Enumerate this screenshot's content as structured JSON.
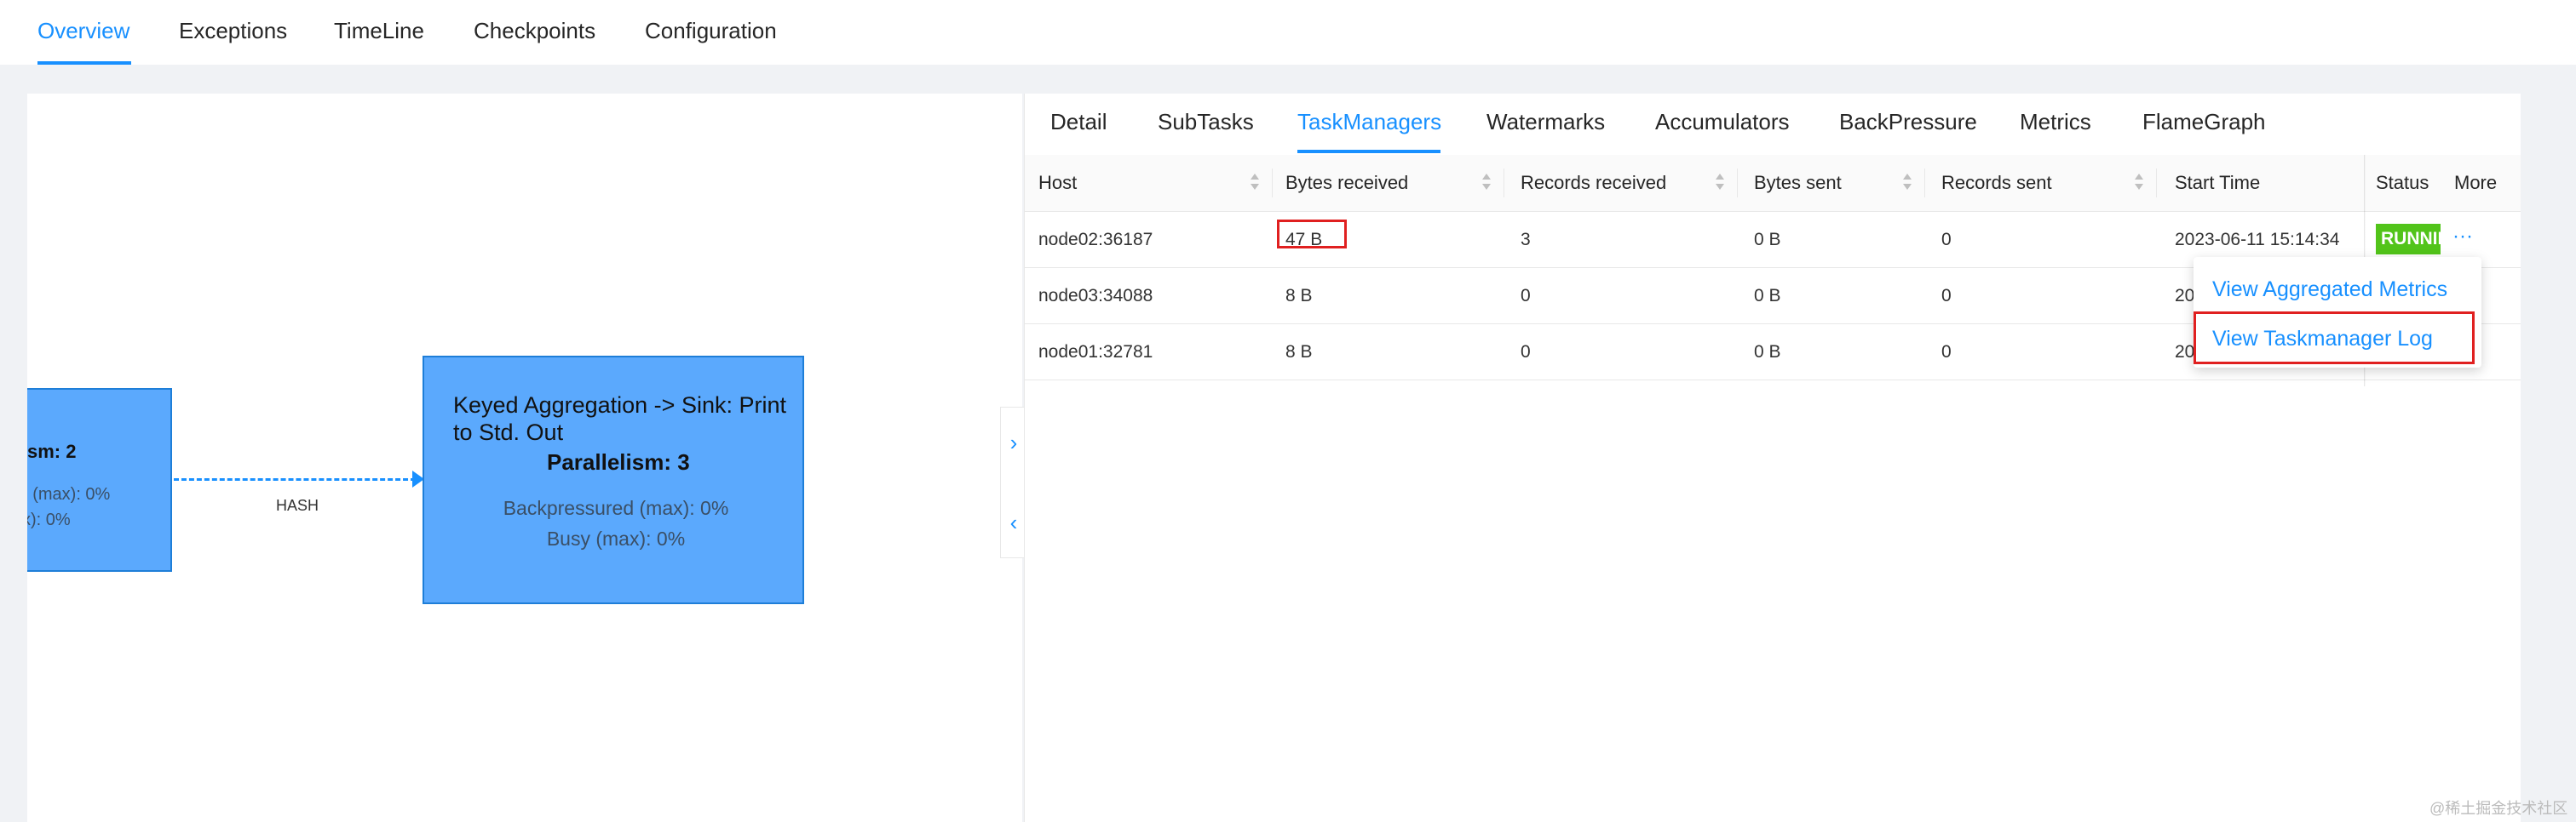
{
  "top_tabs": [
    "Overview",
    "Exceptions",
    "TimeLine",
    "Checkpoints",
    "Configuration"
  ],
  "graph": {
    "node1": {
      "parallelism": "sm: 2",
      "backpressured": ") (max): 0%",
      "busy": "x): 0%"
    },
    "node2": {
      "title": "Keyed Aggregation -> Sink: Print to Std. Out",
      "parallelism": "Parallelism: 3",
      "backpressured": "Backpressured (max): 0%",
      "busy": "Busy (max): 0%"
    },
    "edge_label": "HASH",
    "colors": {
      "node_fill": "#5ba9fd",
      "node_border": "#1e7ed8",
      "edge": "#1890ff"
    }
  },
  "collapse_icons": {
    "right": "›",
    "left": "‹"
  },
  "sub_tabs": [
    "Detail",
    "SubTasks",
    "TaskManagers",
    "Watermarks",
    "Accumulators",
    "BackPressure",
    "Metrics",
    "FlameGraph"
  ],
  "active_sub_tab": "TaskManagers",
  "table": {
    "headers": [
      "Host",
      "Bytes received",
      "Records received",
      "Bytes sent",
      "Records sent",
      "Start Time",
      "Status",
      "More"
    ],
    "rows": [
      {
        "host": "node02:36187",
        "bytes_received": "47 B",
        "records_received": "3",
        "bytes_sent": "0 B",
        "records_sent": "0",
        "start_time": "2023-06-11 15:14:34",
        "status": "RUNNING",
        "more": "···"
      },
      {
        "host": "node03:34088",
        "bytes_received": "8 B",
        "records_received": "0",
        "bytes_sent": "0 B",
        "records_sent": "0",
        "start_time": "20"
      },
      {
        "host": "node01:32781",
        "bytes_received": "8 B",
        "records_received": "0",
        "bytes_sent": "0 B",
        "records_sent": "0",
        "start_time": "20"
      }
    ]
  },
  "more_menu": {
    "items": [
      "View Aggregated Metrics",
      "View Taskmanager Log"
    ]
  },
  "accent_color": "#1890ff",
  "status_color": "#52c41a",
  "highlight_color": "#e02020",
  "watermark": "@稀土掘金技术社区"
}
